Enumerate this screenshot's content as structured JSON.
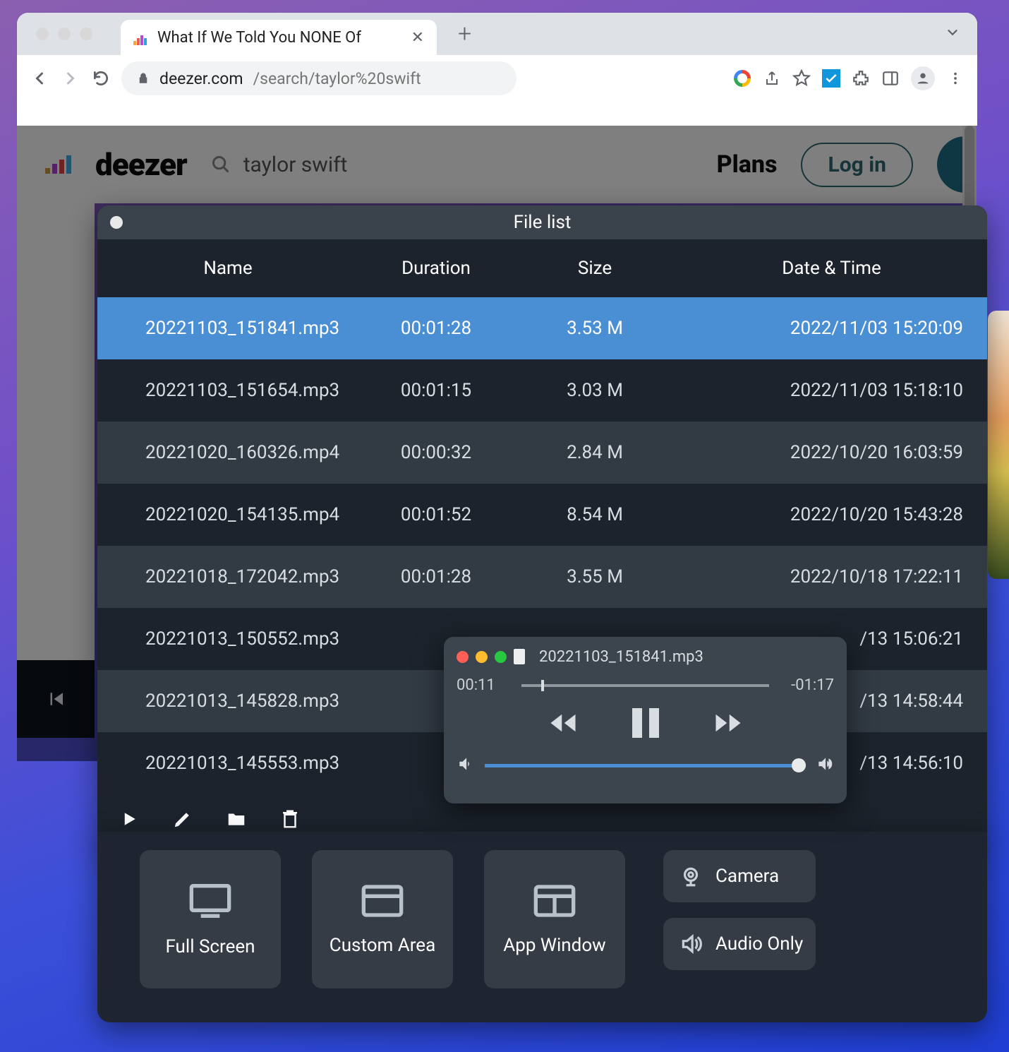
{
  "browser": {
    "tab_title": "What If We Told You NONE Of",
    "url_host": "deezer.com",
    "url_path": "/search/taylor%20swift"
  },
  "deezer": {
    "logo": "deezer",
    "search_query": "taylor swift",
    "plans": "Plans",
    "login": "Log in"
  },
  "filelist": {
    "title": "File list",
    "headers": {
      "name": "Name",
      "duration": "Duration",
      "size": "Size",
      "datetime": "Date & Time"
    },
    "rows": [
      {
        "name": "20221103_151841.mp3",
        "duration": "00:01:28",
        "size": "3.53 M",
        "datetime": "2022/11/03 15:20:09",
        "selected": true
      },
      {
        "name": "20221103_151654.mp3",
        "duration": "00:01:15",
        "size": "3.03 M",
        "datetime": "2022/11/03 15:18:10"
      },
      {
        "name": "20221020_160326.mp4",
        "duration": "00:00:32",
        "size": "2.84 M",
        "datetime": "2022/10/20 16:03:59"
      },
      {
        "name": "20221020_154135.mp4",
        "duration": "00:01:52",
        "size": "8.54 M",
        "datetime": "2022/10/20 15:43:28"
      },
      {
        "name": "20221018_172042.mp3",
        "duration": "00:01:28",
        "size": "3.55 M",
        "datetime": "2022/10/18 17:22:11"
      },
      {
        "name": "20221013_150552.mp3",
        "duration": "",
        "size": "",
        "datetime": "/13 15:06:21"
      },
      {
        "name": "20221013_145828.mp3",
        "duration": "",
        "size": "",
        "datetime": "/13 14:58:44"
      },
      {
        "name": "20221013_145553.mp3",
        "duration": "",
        "size": "",
        "datetime": "/13 14:56:10"
      }
    ]
  },
  "player": {
    "filename": "20221103_151841.mp3",
    "elapsed": "00:11",
    "remaining": "-01:17"
  },
  "recorder": {
    "full_screen": "Full Screen",
    "custom_area": "Custom Area",
    "app_window": "App Window",
    "camera": "Camera",
    "audio_only": "Audio Only"
  }
}
